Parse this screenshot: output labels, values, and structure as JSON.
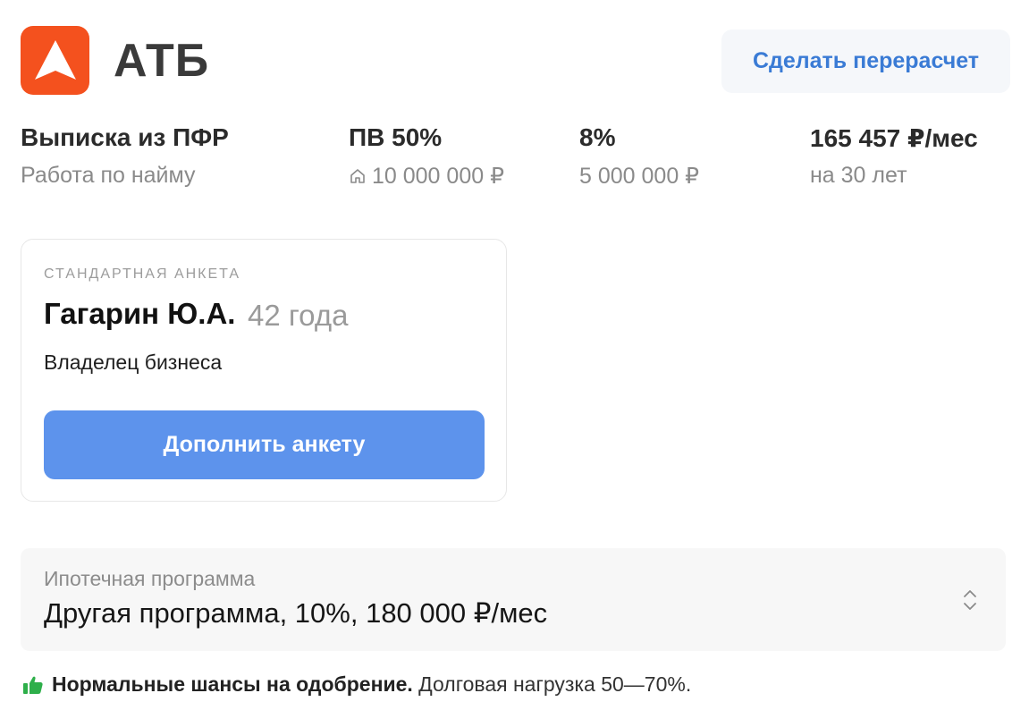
{
  "header": {
    "bank_name": "АТБ",
    "recalc_label": "Сделать перерасчет",
    "brand_color": "#f4511e"
  },
  "stats": [
    {
      "main": "Выписка из ПФР",
      "sub": "Работа по найму"
    },
    {
      "main": "ПВ 50%",
      "sub": "10 000 000 ₽",
      "icon": "house-icon"
    },
    {
      "main": "8%",
      "sub": "5 000 000 ₽"
    },
    {
      "main": "165 457 ₽/мес",
      "sub": "на 30 лет"
    }
  ],
  "card": {
    "caption": "СТАНДАРТНАЯ АНКЕТА",
    "name": "Гагарин Ю.А.",
    "age": "42 года",
    "role": "Владелец бизнеса",
    "button_label": "Дополнить анкету",
    "button_color": "#5d93ec"
  },
  "program": {
    "label": "Ипотечная программа",
    "value": "Другая программа, 10%, 180 000 ₽/мес",
    "icon": "chevron-up-down-icon"
  },
  "approval": {
    "icon": "thumbs-up-icon",
    "icon_color": "#2eaf4a",
    "bold": "Нормальные шансы на одобрение.",
    "text": "Долговая нагрузка 50—70%."
  }
}
